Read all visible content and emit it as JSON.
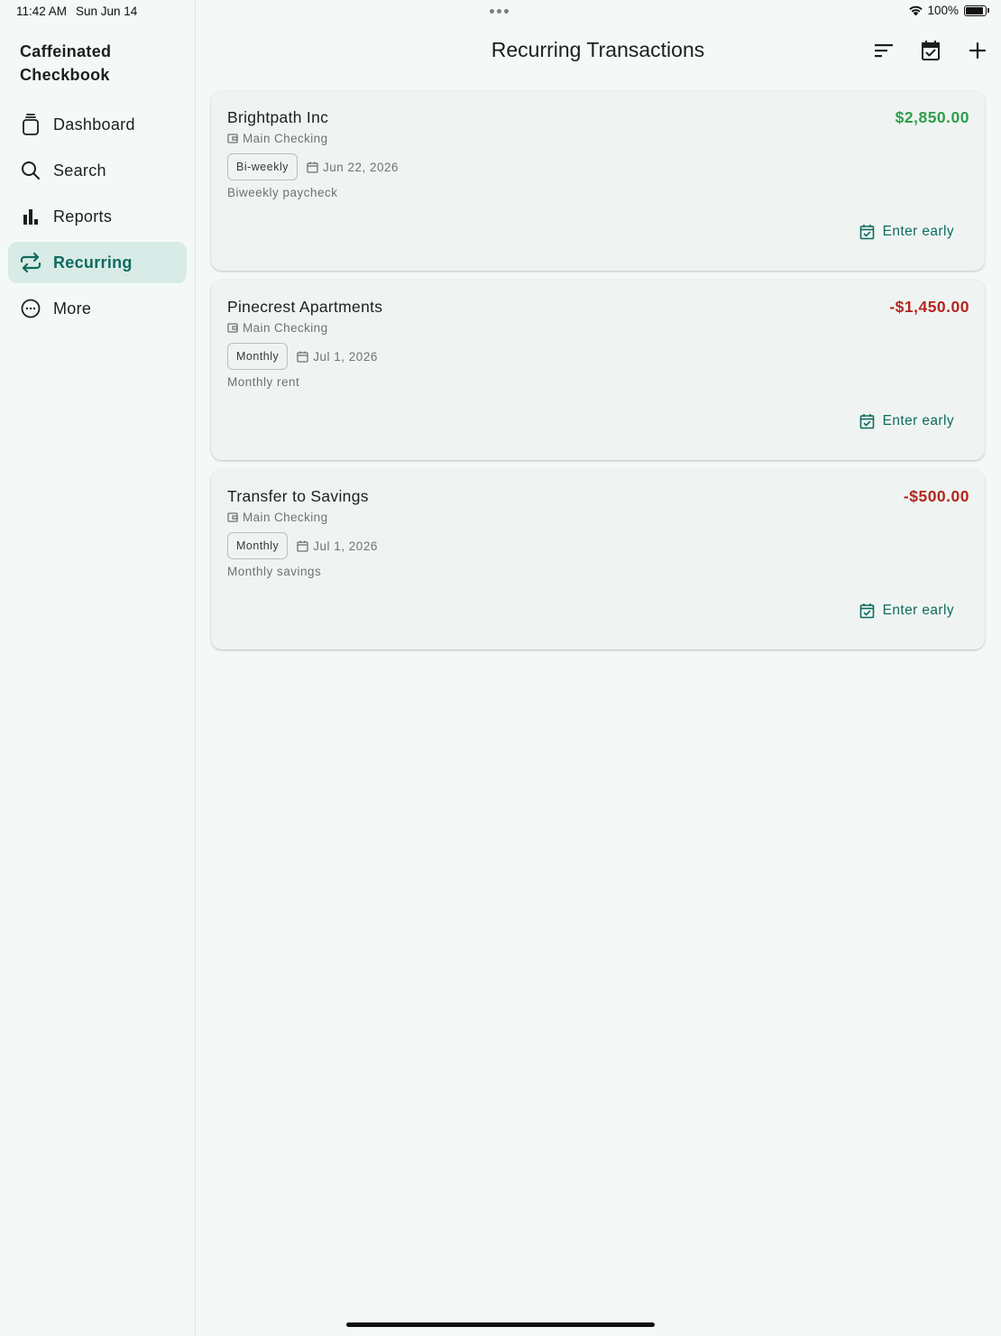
{
  "status_bar": {
    "time": "11:42 AM",
    "date": "Sun Jun 14",
    "battery": "100%",
    "battery_level": 1.0
  },
  "sidebar": {
    "app_title": "Caffeinated Checkbook",
    "items": [
      {
        "label": "Dashboard",
        "icon": "jar-icon",
        "active": false
      },
      {
        "label": "Search",
        "icon": "search-icon",
        "active": false
      },
      {
        "label": "Reports",
        "icon": "bar-chart-icon",
        "active": false
      },
      {
        "label": "Recurring",
        "icon": "repeat-icon",
        "active": true
      },
      {
        "label": "More",
        "icon": "more-horizontal-icon",
        "active": false
      }
    ]
  },
  "header": {
    "title": "Recurring Transactions",
    "actions": [
      "sort-icon",
      "calendar-check-icon",
      "add-icon"
    ]
  },
  "colors": {
    "accent": "#0f6b5d",
    "positive": "#2e9e4a",
    "negative": "#b3261e",
    "active_nav_bg": "#d8ebe6"
  },
  "transactions": [
    {
      "payee": "Brightpath Inc",
      "amount": "$2,850.00",
      "direction": "positive",
      "account": "Main Checking",
      "frequency": "Bi-weekly",
      "next_date": "Jun 22, 2026",
      "memo": "Biweekly paycheck",
      "action_label": "Enter early"
    },
    {
      "payee": "Pinecrest Apartments",
      "amount": "-$1,450.00",
      "direction": "negative",
      "account": "Main Checking",
      "frequency": "Monthly",
      "next_date": "Jul 1, 2026",
      "memo": "Monthly rent",
      "action_label": "Enter early"
    },
    {
      "payee": "Transfer to Savings",
      "amount": "-$500.00",
      "direction": "negative",
      "account": "Main Checking",
      "frequency": "Monthly",
      "next_date": "Jul 1, 2026",
      "memo": "Monthly savings",
      "action_label": "Enter early"
    }
  ]
}
